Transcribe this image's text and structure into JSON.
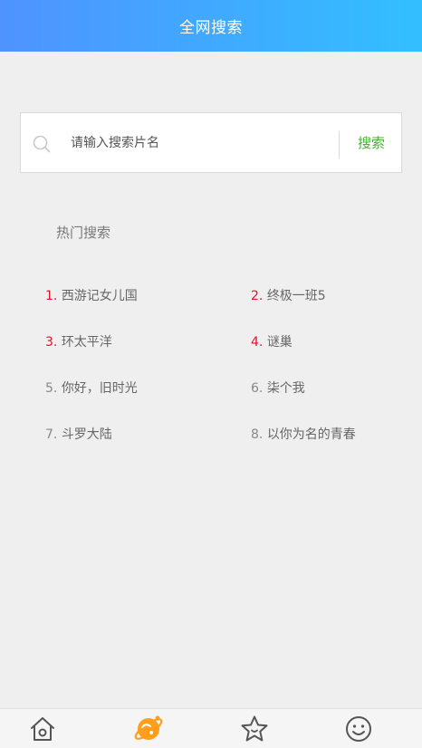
{
  "header": {
    "title": "全网搜索",
    "gradient": [
      "#4f93ff",
      "#32bfff"
    ]
  },
  "search": {
    "placeholder": "请输入搜索片名",
    "value": "",
    "button_label": "搜索",
    "button_color": "#44b22e"
  },
  "hot": {
    "title": "热门搜索",
    "highlight_color": "#e5112c",
    "items": [
      {
        "rank": "1.",
        "name": "西游记女儿国",
        "top": true
      },
      {
        "rank": "2.",
        "name": "终极一班5",
        "top": true
      },
      {
        "rank": "3.",
        "name": "环太平洋",
        "top": true
      },
      {
        "rank": "4.",
        "name": "谜巢",
        "top": true
      },
      {
        "rank": "5.",
        "name": "你好，旧时光",
        "top": false
      },
      {
        "rank": "6.",
        "name": "柒个我",
        "top": false
      },
      {
        "rank": "7.",
        "name": "斗罗大陆",
        "top": false
      },
      {
        "rank": "8.",
        "name": "以你为名的青春",
        "top": false
      }
    ]
  },
  "tabbar": {
    "active_color": "#ff9e1b",
    "tabs": [
      {
        "icon": "home-icon",
        "active": false
      },
      {
        "icon": "planet-icon",
        "active": true
      },
      {
        "icon": "star-icon",
        "active": false
      },
      {
        "icon": "smiley-icon",
        "active": false
      }
    ]
  }
}
